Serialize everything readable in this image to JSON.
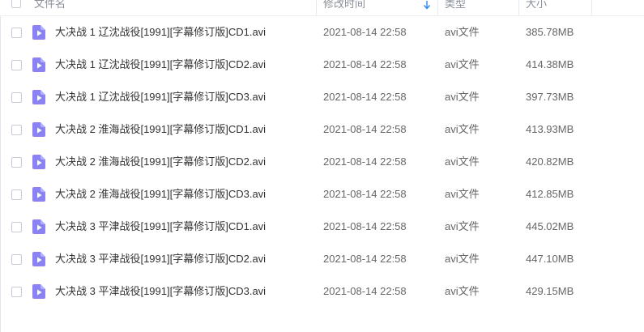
{
  "header": {
    "name_label": "文件名",
    "time_label": "修改时间",
    "type_label": "类型",
    "size_label": "大小"
  },
  "accent_color": "#2e89ef",
  "file_icon_color": "#8b83f3",
  "files": [
    {
      "name": "大决战 1 辽沈战役[1991][字幕修订版]CD1.avi",
      "time": "2021-08-14 22:58",
      "type": "avi文件",
      "size": "385.78MB",
      "icon": "video-file-icon"
    },
    {
      "name": "大决战 1 辽沈战役[1991][字幕修订版]CD2.avi",
      "time": "2021-08-14 22:58",
      "type": "avi文件",
      "size": "414.38MB",
      "icon": "video-file-icon"
    },
    {
      "name": "大决战 1 辽沈战役[1991][字幕修订版]CD3.avi",
      "time": "2021-08-14 22:58",
      "type": "avi文件",
      "size": "397.73MB",
      "icon": "video-file-icon"
    },
    {
      "name": "大决战 2 淮海战役[1991][字幕修订版]CD1.avi",
      "time": "2021-08-14 22:58",
      "type": "avi文件",
      "size": "413.93MB",
      "icon": "video-file-icon"
    },
    {
      "name": "大决战 2 淮海战役[1991][字幕修订版]CD2.avi",
      "time": "2021-08-14 22:58",
      "type": "avi文件",
      "size": "420.82MB",
      "icon": "video-file-icon"
    },
    {
      "name": "大决战 2 淮海战役[1991][字幕修订版]CD3.avi",
      "time": "2021-08-14 22:58",
      "type": "avi文件",
      "size": "412.85MB",
      "icon": "video-file-icon"
    },
    {
      "name": "大决战 3 平津战役[1991][字幕修订版]CD1.avi",
      "time": "2021-08-14 22:58",
      "type": "avi文件",
      "size": "445.02MB",
      "icon": "video-file-icon"
    },
    {
      "name": "大决战 3 平津战役[1991][字幕修订版]CD2.avi",
      "time": "2021-08-14 22:58",
      "type": "avi文件",
      "size": "447.10MB",
      "icon": "video-file-icon"
    },
    {
      "name": "大决战 3 平津战役[1991][字幕修订版]CD3.avi",
      "time": "2021-08-14 22:58",
      "type": "avi文件",
      "size": "429.15MB",
      "icon": "video-file-icon"
    }
  ]
}
